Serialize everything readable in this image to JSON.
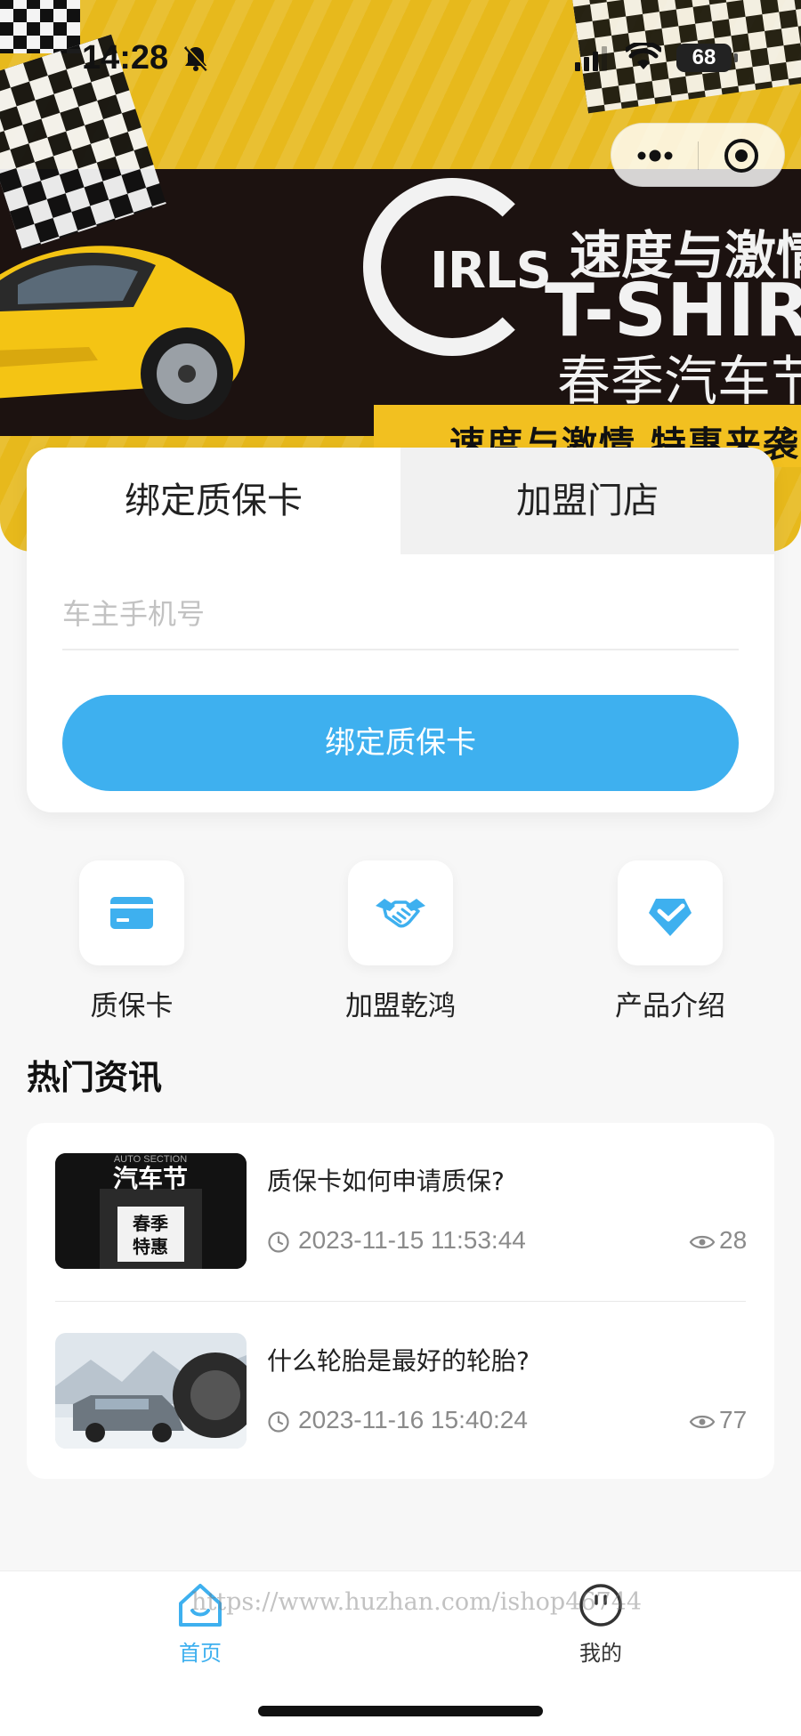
{
  "status_bar": {
    "time": "14:28",
    "battery": "68"
  },
  "banner": {
    "headline_cn": "速度与激情",
    "brand_prefix": "IRLS",
    "brand_main": "T-SHIR",
    "subtitle_cn": "春季汽车节",
    "tagline_cn": "速度与激情 特惠来袭"
  },
  "bind_card": {
    "tabs": [
      {
        "label": "绑定质保卡"
      },
      {
        "label": "加盟门店"
      }
    ],
    "phone_placeholder": "车主手机号",
    "button_label": "绑定质保卡"
  },
  "quick_links": [
    {
      "label": "质保卡",
      "icon": "card-icon"
    },
    {
      "label": "加盟乾鸿",
      "icon": "handshake-icon"
    },
    {
      "label": "产品介绍",
      "icon": "badge-check-icon"
    }
  ],
  "news": {
    "title": "热门资讯",
    "items": [
      {
        "title": "质保卡如何申请质保?",
        "time": "2023-11-15 11:53:44",
        "views": "28",
        "thumb_text_1": "汽车节",
        "thumb_text_2": "春季",
        "thumb_text_3": "特惠",
        "thumb_caption": "AUTO SECTION"
      },
      {
        "title": "什么轮胎是最好的轮胎?",
        "time": "2023-11-16 15:40:24",
        "views": "77"
      }
    ]
  },
  "tabbar": {
    "items": [
      {
        "label": "首页",
        "icon": "home-icon"
      },
      {
        "label": "我的",
        "icon": "user-icon"
      }
    ]
  },
  "watermark": "https://www.huzhan.com/ishop46744",
  "colors": {
    "accent": "#3eb0ef",
    "banner_yellow": "#e7b91c"
  }
}
